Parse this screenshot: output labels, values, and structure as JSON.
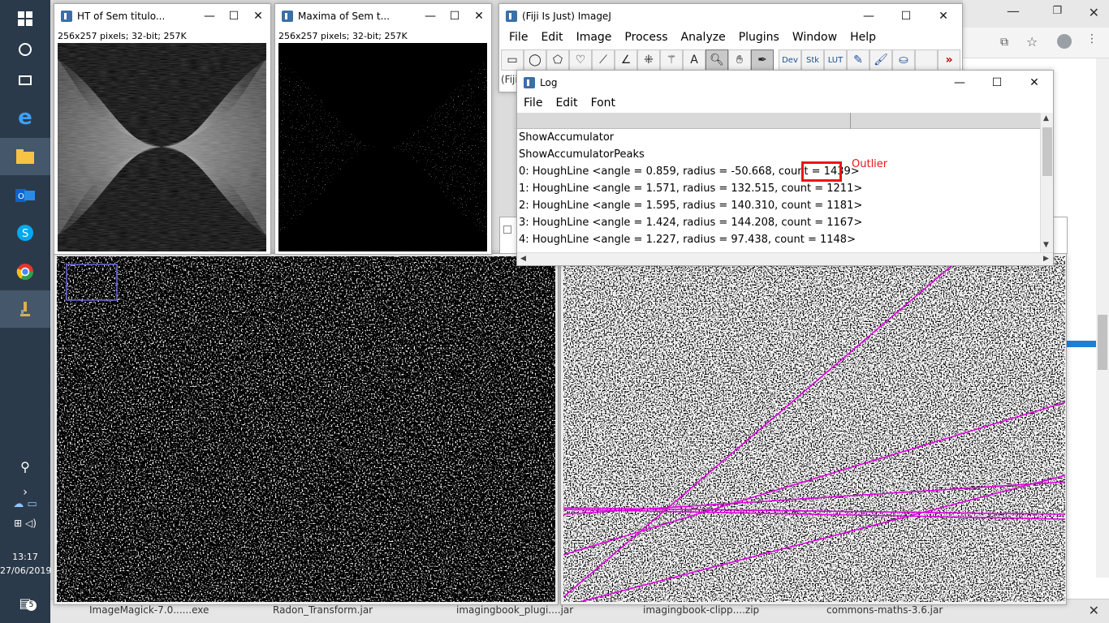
{
  "taskbar": {
    "time": "13:17",
    "date": "27/06/2019",
    "notification_count": "5"
  },
  "windows": {
    "ht": {
      "title": "HT of Sem titulo...",
      "info": "256x257 pixels; 32-bit; 257K"
    },
    "maxima": {
      "title": "Maxima of Sem t...",
      "info": "256x257 pixels; 32-bit; 257K"
    },
    "imagej": {
      "title": "(Fiji Is Just) ImageJ",
      "menus": [
        "File",
        "Edit",
        "Image",
        "Process",
        "Analyze",
        "Plugins",
        "Window",
        "Help"
      ],
      "tool_labels": {
        "text": "A",
        "dev": "Dev",
        "stk": "Stk",
        "lut": "LUT",
        "more": "»"
      },
      "status_fragment": "(Fiji"
    },
    "log": {
      "title": "Log",
      "menus": [
        "File",
        "Edit",
        "Font"
      ],
      "lines": [
        "ShowAccumulator",
        "ShowAccumulatorPeaks",
        "0: HoughLine <angle = 0.859, radius = -50.668, count = 1439>",
        "1: HoughLine <angle = 1.571, radius = 132.515, count = 1211>",
        "2: HoughLine <angle = 1.595, radius = 140.310, count = 1181>",
        "3: HoughLine <angle = 1.424, radius = 144.208, count = 1167>",
        "4: HoughLine <angle = 1.227, radius = 97.438, count = 1148>"
      ],
      "annotation": "Outlier"
    }
  },
  "bottom_taskbar": {
    "items": [
      "ImageMagick-7.0......exe",
      "Radon_Transform.jar",
      "imagingbook_plugi....jar",
      "imagingbook-clipp....zip",
      "commons-maths-3.6.jar"
    ]
  },
  "colors": {
    "outlier": "#e8141a",
    "hough_lines": "#e000e0",
    "taskbar": "#2b3a4a"
  }
}
